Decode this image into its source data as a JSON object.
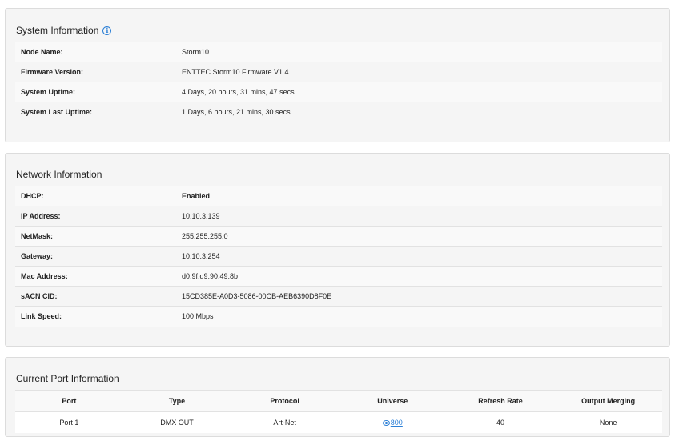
{
  "system": {
    "title": "System Information",
    "rows": [
      {
        "label": "Node Name:",
        "value": "Storm10"
      },
      {
        "label": "Firmware Version:",
        "value": "ENTTEC Storm10 Firmware V1.4"
      },
      {
        "label": "System Uptime:",
        "value": "4 Days, 20 hours, 31 mins, 47 secs"
      },
      {
        "label": "System Last Uptime:",
        "value": "1 Days, 6 hours, 21 mins, 30 secs"
      }
    ]
  },
  "network": {
    "title": "Network Information",
    "rows": [
      {
        "label": "DHCP:",
        "value": "Enabled"
      },
      {
        "label": "IP Address:",
        "value": "10.10.3.139"
      },
      {
        "label": "NetMask:",
        "value": "255.255.255.0"
      },
      {
        "label": "Gateway:",
        "value": "10.10.3.254"
      },
      {
        "label": "Mac Address:",
        "value": "d0:9f:d9:90:49:8b"
      },
      {
        "label": "sACN CID:",
        "value": "15CD385E-A0D3-5086-00CB-AEB6390D8F0E"
      },
      {
        "label": "Link Speed:",
        "value": "100 Mbps"
      }
    ],
    "status_color": "#2e8b2e"
  },
  "ports": {
    "title": "Current Port Information",
    "headers": [
      "Port",
      "Type",
      "Protocol",
      "Universe",
      "Refresh Rate",
      "Output Merging"
    ],
    "rows": [
      {
        "port": "Port 1",
        "type": "DMX OUT",
        "protocol": "Art-Net",
        "universe": "800",
        "refresh": "40",
        "merging": "None"
      }
    ]
  },
  "colors": {
    "link": "#2b7fd6",
    "panel_bg": "#f5f5f5"
  },
  "icons": {
    "info": "info-circle-icon",
    "view": "eye-icon"
  }
}
